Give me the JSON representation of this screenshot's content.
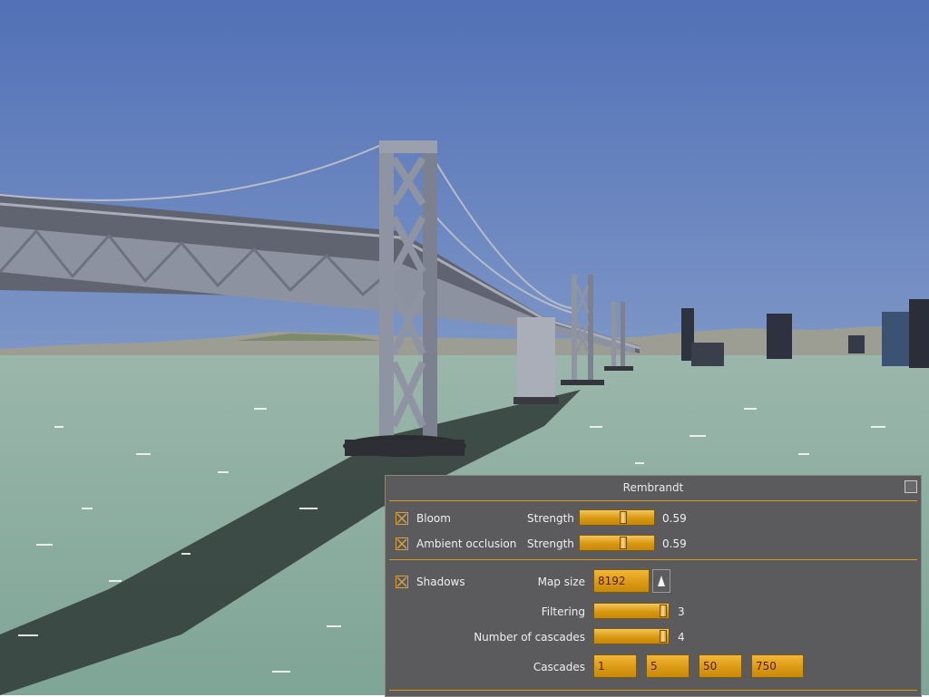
{
  "dialog": {
    "title": "Rembrandt",
    "bloom": {
      "label": "Bloom",
      "checked": true,
      "strength_label": "Strength",
      "strength_value": "0.59",
      "slider_level": 0.59
    },
    "ambient_occlusion": {
      "label": "Ambient occlusion",
      "checked": true,
      "strength_label": "Strength",
      "strength_value": "0.59",
      "slider_level": 0.59
    },
    "shadows": {
      "label": "Shadows",
      "checked": true,
      "map_size_label": "Map size",
      "map_size_value": "8192",
      "filtering_label": "Filtering",
      "filtering_value": "3",
      "cascades_count_label": "Number of cascades",
      "cascades_count_value": "4",
      "cascades_label": "Cascades",
      "cascades": [
        "1",
        "5",
        "50",
        "750"
      ]
    }
  },
  "colors": {
    "accent": "#d99811",
    "panel_bg": "#5b5a5d",
    "sky": "#5a7cbc",
    "water": "#8aaea0"
  }
}
